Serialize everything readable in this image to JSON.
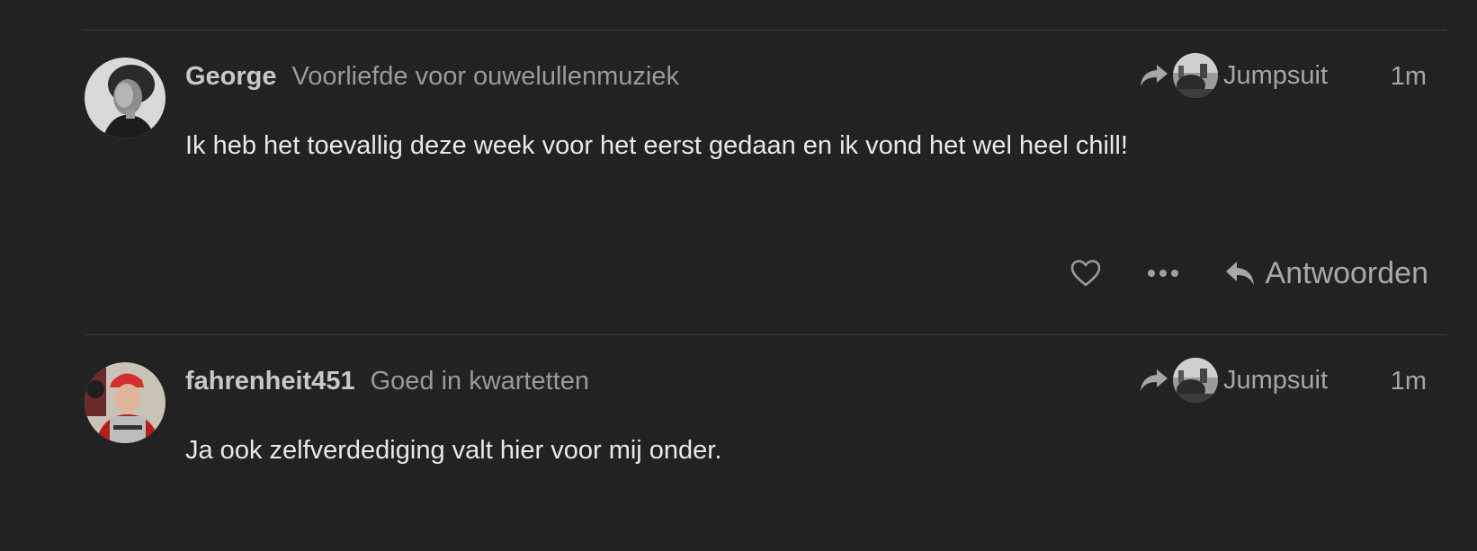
{
  "posts": [
    {
      "username": "George",
      "user_title": "Voorliefde voor ouwelullenmuziek",
      "avatar_icon": "user-avatar-bw-portrait",
      "reply_to": {
        "icon": "share-arrow-icon",
        "name": "Jumpsuit"
      },
      "date": "1m",
      "body": "Ik heb het toevallig deze week voor het eerst gedaan en ik vond het wel heel chill!",
      "actions": {
        "like_icon": "heart-icon",
        "more_icon": "ellipsis-icon",
        "reply_label": "Antwoorden"
      }
    },
    {
      "username": "fahrenheit451",
      "user_title": "Goed in kwartetten",
      "avatar_icon": "user-avatar-red-cap",
      "reply_to": {
        "icon": "share-arrow-icon",
        "name": "Jumpsuit"
      },
      "date": "1m",
      "body": "Ja ook zelfverdediging valt hier voor mij onder."
    }
  ],
  "colors": {
    "background": "#222222",
    "divider": "#3a3a3a",
    "username": "#c8c8c8",
    "muted": "#9a9a9a",
    "body": "#e8e8e8"
  }
}
